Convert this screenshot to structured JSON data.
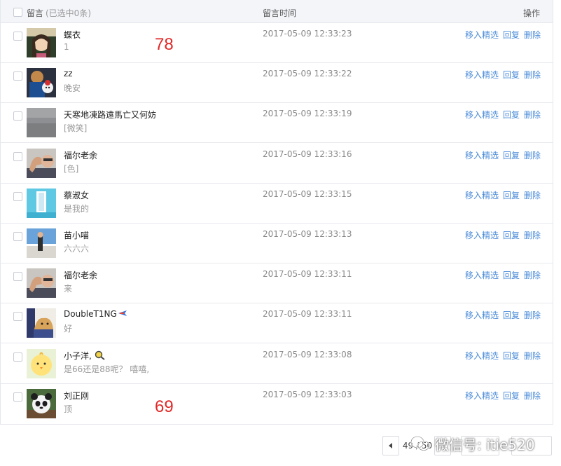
{
  "header": {
    "col_message": "留言",
    "selected_count": "(已选中0条)",
    "col_time": "留言时间",
    "col_ops": "操作"
  },
  "ops": {
    "featured": "移入精选",
    "reply": "回复",
    "delete": "删除"
  },
  "rows": [
    {
      "name": "蝶衣",
      "content": "1",
      "time": "2017-05-09 12:33:23",
      "avatar": "avatar-anime-girl"
    },
    {
      "name": "zz",
      "content": "晚安",
      "time": "2017-05-09 12:33:22",
      "avatar": "avatar-person-toy"
    },
    {
      "name": "天寒地凍路遠馬亡又何妨",
      "content": "[微笑]",
      "time": "2017-05-09 12:33:19",
      "avatar": "avatar-grey-fog"
    },
    {
      "name": "福尔老余",
      "content": "[色]",
      "time": "2017-05-09 12:33:16",
      "avatar": "avatar-flex-arm"
    },
    {
      "name": "蔡淑女",
      "content": "是我的",
      "time": "2017-05-09 12:33:15",
      "avatar": "avatar-cyan-photo"
    },
    {
      "name": "苗小喵",
      "content": "六六六",
      "time": "2017-05-09 12:33:13",
      "avatar": "avatar-seaside-person"
    },
    {
      "name": "福尔老余",
      "content": "来",
      "time": "2017-05-09 12:33:11",
      "avatar": "avatar-flex-arm"
    },
    {
      "name": "DoubleT1NG",
      "content": "好",
      "time": "2017-05-09 12:33:11",
      "avatar": "avatar-dog"
    },
    {
      "name": "小子洋,",
      "content": "是66还是88呢？ 嘻嘻,",
      "time": "2017-05-09 12:33:08",
      "avatar": "avatar-yellow-chick"
    },
    {
      "name": "刘正刚",
      "content": "顶",
      "time": "2017-05-09 12:33:03",
      "avatar": "avatar-panda"
    }
  ],
  "annotations": {
    "top": "78",
    "bottom": "69"
  },
  "pager": {
    "info": "49 / 50"
  },
  "watermark": "微信号: itie520"
}
